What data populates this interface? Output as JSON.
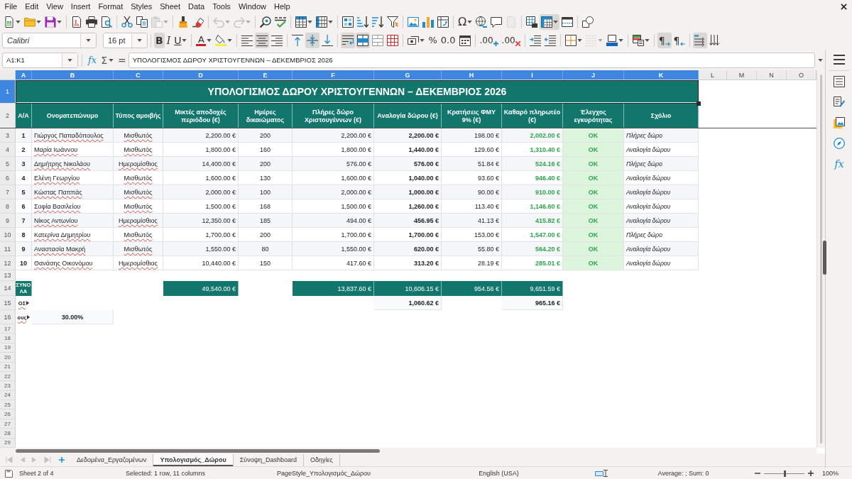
{
  "menu_bar": {
    "items": [
      "File",
      "Edit",
      "View",
      "Insert",
      "Format",
      "Styles",
      "Sheet",
      "Data",
      "Tools",
      "Window",
      "Help"
    ]
  },
  "standard_toolbar": {
    "groups": [
      [
        {
          "kind": "new",
          "dropdown": true,
          "on": false,
          "disabled": false
        },
        {
          "kind": "open",
          "dropdown": true,
          "on": false,
          "disabled": false
        },
        {
          "kind": "save",
          "dropdown": true,
          "on": false,
          "disabled": false
        }
      ],
      [
        {
          "kind": "export-pdf",
          "dropdown": false,
          "on": false,
          "disabled": false
        },
        {
          "kind": "print",
          "dropdown": false,
          "on": false,
          "disabled": false
        },
        {
          "kind": "print-preview",
          "dropdown": false,
          "on": false,
          "disabled": false
        }
      ],
      [
        {
          "kind": "cut",
          "dropdown": false,
          "on": false,
          "disabled": false
        },
        {
          "kind": "copy",
          "dropdown": false,
          "on": false,
          "disabled": false
        },
        {
          "kind": "paste",
          "dropdown": true,
          "on": false,
          "disabled": true
        }
      ],
      [
        {
          "kind": "clone-format",
          "dropdown": false,
          "on": false,
          "disabled": false
        },
        {
          "kind": "clear-format",
          "dropdown": false,
          "on": false,
          "disabled": false
        }
      ],
      [
        {
          "kind": "undo",
          "dropdown": true,
          "on": false,
          "disabled": true
        },
        {
          "kind": "redo",
          "dropdown": true,
          "on": false,
          "disabled": true
        }
      ],
      [
        {
          "kind": "find-replace",
          "dropdown": false,
          "on": false,
          "disabled": false
        },
        {
          "kind": "spelling",
          "dropdown": false,
          "on": false,
          "disabled": false
        }
      ],
      [
        {
          "kind": "rows",
          "dropdown": true,
          "on": false,
          "disabled": false
        },
        {
          "kind": "columns",
          "dropdown": true,
          "on": false,
          "disabled": false
        }
      ],
      [
        {
          "kind": "sort",
          "dropdown": false,
          "on": false,
          "disabled": false
        },
        {
          "kind": "sort-ascending",
          "dropdown": false,
          "on": false,
          "disabled": false
        },
        {
          "kind": "sort-descending",
          "dropdown": false,
          "on": false,
          "disabled": false
        },
        {
          "kind": "autofilter",
          "dropdown": false,
          "on": false,
          "disabled": false
        }
      ],
      [
        {
          "kind": "image",
          "dropdown": false,
          "on": false,
          "disabled": false
        },
        {
          "kind": "chart",
          "dropdown": false,
          "on": false,
          "disabled": false
        },
        {
          "kind": "pivot-table",
          "dropdown": false,
          "on": false,
          "disabled": false
        }
      ],
      [
        {
          "kind": "special-character",
          "glyph": "Ω",
          "dropdown": true,
          "on": false,
          "disabled": false
        },
        {
          "kind": "hyperlink",
          "dropdown": false,
          "on": false,
          "disabled": false
        },
        {
          "kind": "comment",
          "dropdown": false,
          "on": false,
          "disabled": false
        },
        {
          "kind": "header-footer",
          "dropdown": false,
          "on": false,
          "disabled": true
        }
      ],
      [
        {
          "kind": "print-area",
          "dropdown": false,
          "on": false,
          "disabled": false
        },
        {
          "kind": "freeze",
          "dropdown": true,
          "on": true,
          "disabled": false
        },
        {
          "kind": "split-window",
          "dropdown": false,
          "on": false,
          "disabled": false
        }
      ],
      [
        {
          "kind": "shapes",
          "dropdown": false,
          "on": false,
          "disabled": false
        }
      ]
    ]
  },
  "formatting_toolbar": {
    "font_name": "Calibri",
    "font_size": "16 pt",
    "groups": [
      [
        {
          "kind": "bold",
          "glyph": "B",
          "dropdown": false,
          "on": true,
          "disabled": false
        },
        {
          "kind": "italic",
          "glyph": "I",
          "dropdown": false,
          "on": false,
          "disabled": false
        },
        {
          "kind": "underline",
          "glyph": "U",
          "dropdown": true,
          "on": false,
          "disabled": false
        }
      ],
      [
        {
          "kind": "font-color",
          "glyph": "A",
          "dropdown": true,
          "on": false,
          "disabled": false
        },
        {
          "kind": "highlight",
          "dropdown": true,
          "on": false,
          "disabled": false
        }
      ],
      [
        {
          "kind": "align-left",
          "dropdown": false,
          "on": false,
          "disabled": false
        },
        {
          "kind": "align-center",
          "dropdown": false,
          "on": true,
          "disabled": false
        },
        {
          "kind": "align-right",
          "dropdown": false,
          "on": false,
          "disabled": false
        }
      ],
      [
        {
          "kind": "align-top",
          "dropdown": false,
          "on": false,
          "disabled": false
        },
        {
          "kind": "align-middle",
          "dropdown": false,
          "on": true,
          "disabled": false
        },
        {
          "kind": "align-bottom",
          "dropdown": false,
          "on": false,
          "disabled": false
        }
      ],
      [
        {
          "kind": "wrap",
          "dropdown": false,
          "on": true,
          "disabled": false
        },
        {
          "kind": "merge-center",
          "dropdown": false,
          "on": true,
          "disabled": false
        },
        {
          "kind": "merge",
          "dropdown": false,
          "on": false,
          "disabled": false
        },
        {
          "kind": "unmerge",
          "dropdown": false,
          "on": false,
          "disabled": false
        }
      ],
      [
        {
          "kind": "currency",
          "dropdown": true,
          "on": false,
          "disabled": false
        },
        {
          "kind": "percent",
          "glyph": "%",
          "dropdown": false,
          "on": false,
          "disabled": false
        },
        {
          "kind": "number",
          "glyph": "0.0",
          "dropdown": false,
          "on": false,
          "disabled": false
        },
        {
          "kind": "date",
          "dropdown": false,
          "on": false,
          "disabled": false
        }
      ],
      [
        {
          "kind": "add-decimal",
          "glyph": ".00",
          "dropdown": false,
          "on": false,
          "disabled": false
        },
        {
          "kind": "delete-decimal",
          "glyph": ".00",
          "dropdown": false,
          "on": false,
          "disabled": false
        }
      ],
      [
        {
          "kind": "indent",
          "dropdown": false,
          "on": false,
          "disabled": false
        },
        {
          "kind": "outdent",
          "dropdown": false,
          "on": false,
          "disabled": false
        }
      ],
      [
        {
          "kind": "borders",
          "dropdown": true,
          "on": false,
          "disabled": false
        },
        {
          "kind": "border-style",
          "dropdown": true,
          "on": false,
          "disabled": true
        },
        {
          "kind": "border-color",
          "dropdown": true,
          "on": false,
          "disabled": false
        }
      ],
      [
        {
          "kind": "conditional",
          "dropdown": true,
          "on": false,
          "disabled": false
        }
      ],
      [
        {
          "kind": "ltr",
          "glyph": "¶",
          "dropdown": false,
          "on": true,
          "disabled": false
        },
        {
          "kind": "rtl",
          "glyph": "¶",
          "dropdown": false,
          "on": false,
          "disabled": false
        }
      ],
      [
        {
          "kind": "text-ltr",
          "dropdown": false,
          "on": true,
          "disabled": false
        },
        {
          "kind": "text-ttb",
          "dropdown": false,
          "on": false,
          "disabled": false
        }
      ]
    ]
  },
  "formula_bar": {
    "name_box": "A1:K1",
    "function_wizard": "fx",
    "sum": "Σ",
    "equals": "=",
    "formula": "ΥΠΟΛΟΓΙΣΜΟΣ ΔΩΡΟΥ ΧΡΙΣΤΟΥΓΕΝΝΩΝ – ΔΕΚΕΜΒΡΙΟΣ 2026"
  },
  "sheet": {
    "columns": [
      {
        "label": "A",
        "selected": true
      },
      {
        "label": "B",
        "selected": true
      },
      {
        "label": "C",
        "selected": true
      },
      {
        "label": "D",
        "selected": true
      },
      {
        "label": "E",
        "selected": true
      },
      {
        "label": "F",
        "selected": true
      },
      {
        "label": "G",
        "selected": true
      },
      {
        "label": "H",
        "selected": true
      },
      {
        "label": "I",
        "selected": true
      },
      {
        "label": "J",
        "selected": true
      },
      {
        "label": "K",
        "selected": true
      },
      {
        "label": "L",
        "selected": false
      },
      {
        "label": "M",
        "selected": false
      },
      {
        "label": "N",
        "selected": false
      },
      {
        "label": "O",
        "selected": false
      }
    ],
    "rows": [
      {
        "label": "1",
        "selected": true
      },
      {
        "label": "2",
        "selected": false
      },
      {
        "label": "3",
        "selected": false
      },
      {
        "label": "4",
        "selected": false
      },
      {
        "label": "5",
        "selected": false
      },
      {
        "label": "6",
        "selected": false
      },
      {
        "label": "7",
        "selected": false
      },
      {
        "label": "8",
        "selected": false
      },
      {
        "label": "9",
        "selected": false
      },
      {
        "label": "10",
        "selected": false
      },
      {
        "label": "11",
        "selected": false
      },
      {
        "label": "12",
        "selected": false
      },
      {
        "label": "13",
        "selected": false
      },
      {
        "label": "14",
        "selected": false
      },
      {
        "label": "15",
        "selected": false
      },
      {
        "label": "16",
        "selected": false
      },
      {
        "label": "17",
        "selected": false
      },
      {
        "label": "18",
        "selected": false
      },
      {
        "label": "19",
        "selected": false
      },
      {
        "label": "20",
        "selected": false
      },
      {
        "label": "21",
        "selected": false
      },
      {
        "label": "22",
        "selected": false
      },
      {
        "label": "23",
        "selected": false
      },
      {
        "label": "24",
        "selected": false
      },
      {
        "label": "25",
        "selected": false
      },
      {
        "label": "26",
        "selected": false
      },
      {
        "label": "27",
        "selected": false
      },
      {
        "label": "28",
        "selected": false
      },
      {
        "label": "29",
        "selected": false
      }
    ],
    "title": {
      "text": "ΥΠΟΛΟΓΙΣΜΟΣ ΔΩΡΟΥ ΧΡΙΣΤΟΥΓΕΝΝΩΝ – ΔΕΚΕΜΒΡΙΟΣ 2026",
      "selected": true
    },
    "headers": [
      "Α/Α",
      "Ονοματεπώνυμο",
      "Τύπος αμοιβής",
      "Μικτές αποδοχές περιόδου (€)",
      "Ημέρες δικαιώματος",
      "Πλήρες δώρο Χριστουγέννων (€)",
      "Αναλογία δώρου (€)",
      "Κρατήσεις ΦΜΥ 9% (€)",
      "Καθαρό πληρωτέο (€)",
      "Έλεγχος εγκυρότητας",
      "Σχόλιο"
    ],
    "data_rows": [
      [
        "1",
        "Γιώργος Παπαδόπουλος",
        "Μισθωτός",
        "2,200.00 €",
        "200",
        "2,200.00 €",
        "2,200.00 €",
        "198.00 €",
        "2,002.00 €",
        "OK",
        "Πλήρες δώρο"
      ],
      [
        "2",
        "Μαρία Ιωάννου",
        "Μισθωτός",
        "1,800.00 €",
        "160",
        "1,800.00 €",
        "1,440.00 €",
        "129.60 €",
        "1,310.40 €",
        "OK",
        "Αναλογία δώρου"
      ],
      [
        "3",
        "Δημήτρης Νικολάου",
        "Ημερομίσθιος",
        "14,400.00 €",
        "200",
        "576.00 €",
        "576.00 €",
        "51.84 €",
        "524.16 €",
        "OK",
        "Πλήρες δώρο"
      ],
      [
        "4",
        "Ελένη Γεωργίου",
        "Μισθωτός",
        "1,600.00 €",
        "130",
        "1,600.00 €",
        "1,040.00 €",
        "93.60 €",
        "946.40 €",
        "OK",
        "Αναλογία δώρου"
      ],
      [
        "5",
        "Κώστας Παππάς",
        "Μισθωτός",
        "2,000.00 €",
        "100",
        "2,000.00 €",
        "1,000.00 €",
        "90.00 €",
        "910.00 €",
        "OK",
        "Αναλογία δώρου"
      ],
      [
        "6",
        "Σοφία Βασιλείου",
        "Μισθωτός",
        "1,500.00 €",
        "168",
        "1,500.00 €",
        "1,260.00 €",
        "113.40 €",
        "1,146.60 €",
        "OK",
        "Αναλογία δώρου"
      ],
      [
        "7",
        "Νίκος Αντωνίου",
        "Ημερομίσθιος",
        "12,350.00 €",
        "185",
        "494.00 €",
        "456.95 €",
        "41.13 €",
        "415.82 €",
        "OK",
        "Αναλογία δώρου"
      ],
      [
        "8",
        "Κατερίνα Δημητρίου",
        "Μισθωτός",
        "1,700.00 €",
        "200",
        "1,700.00 €",
        "1,700.00 €",
        "153.00 €",
        "1,547.00 €",
        "OK",
        "Πλήρες δώρο"
      ],
      [
        "9",
        "Αναστασία Μακρή",
        "Μισθωτός",
        "1,550.00 €",
        "80",
        "1,550.00 €",
        "620.00 €",
        "55.80 €",
        "564.20 €",
        "OK",
        "Αναλογία δώρου"
      ],
      [
        "10",
        "Θανάσης Οικονόμου",
        "Ημερομίσθιος",
        "10,440.00 €",
        "150",
        "417.60 €",
        "313.20 €",
        "28.19 €",
        "285.01 €",
        "OK",
        "Αναλογία δώρου"
      ]
    ],
    "summary_rows": [
      {
        "cells": [
          {
            "kind": "total",
            "text": "ΣΥΝΟΛΑ"
          },
          {
            "kind": "blank"
          },
          {
            "kind": "blank"
          },
          {
            "kind": "total",
            "text": "49,540.00 €"
          },
          {
            "kind": "blank"
          },
          {
            "kind": "total",
            "text": "13,837.60 €"
          },
          {
            "kind": "total",
            "text": "10,606.15 €"
          },
          {
            "kind": "total",
            "text": "954.56 €"
          },
          {
            "kind": "total",
            "text": "9,651.59 €"
          }
        ]
      },
      {
        "cells": [
          {
            "kind": "overflow",
            "text": "ΟΣ"
          },
          {
            "kind": "blank"
          },
          {
            "kind": "blank"
          },
          {
            "kind": "blank"
          },
          {
            "kind": "blank"
          },
          {
            "kind": "blank"
          },
          {
            "kind": "summary",
            "text": "1,060.62 €"
          },
          {
            "kind": "blank"
          },
          {
            "kind": "summary",
            "text": "965.16 €"
          }
        ]
      },
      {
        "cells": [
          {
            "kind": "overflow",
            "text": "ους"
          },
          {
            "kind": "summary",
            "text": "30.00%"
          }
        ]
      }
    ]
  },
  "sheet_tabs": {
    "navigation": [
      {
        "kind": "first",
        "disabled": true
      },
      {
        "kind": "previous",
        "disabled": true
      },
      {
        "kind": "next",
        "disabled": true
      },
      {
        "kind": "last",
        "disabled": true
      }
    ],
    "tabs": [
      {
        "label": "Δεδομένα_Εργαζομένων",
        "selected": false
      },
      {
        "label": "Υπολογισμός_Δώρου",
        "selected": true
      },
      {
        "label": "Σύνοψη_Dashboard",
        "selected": false
      },
      {
        "label": "Οδηγίες",
        "selected": false
      }
    ]
  },
  "sidebar": {
    "items": [
      {
        "kind": "menu"
      },
      {
        "kind": "properties"
      },
      {
        "kind": "styles"
      },
      {
        "kind": "gallery"
      },
      {
        "kind": "navigator"
      },
      {
        "kind": "functions",
        "glyph": "fx"
      }
    ]
  },
  "status_bar": {
    "sheet": "Sheet 2 of 4",
    "selection": "Selected: 1 row, 11 columns",
    "page_style": "PageStyle_Υπολογισμός_Δώρου",
    "language": "English (USA)",
    "statistics": "Average: ; Sum: 0",
    "zoom": {
      "level": 0.5,
      "reading": "100%"
    }
  }
}
